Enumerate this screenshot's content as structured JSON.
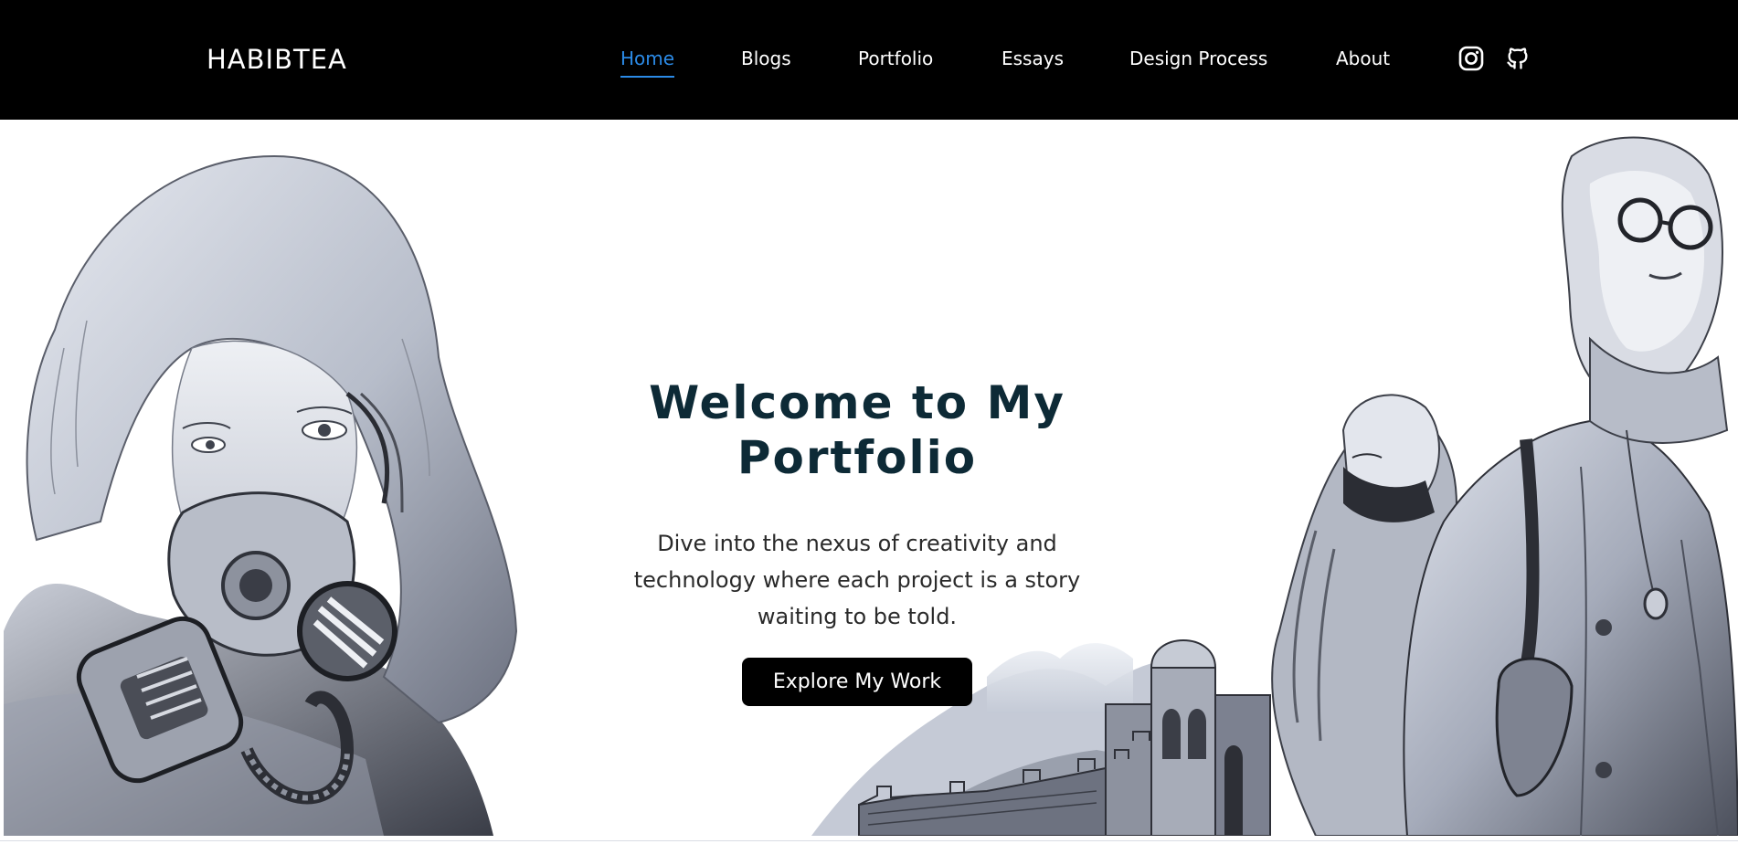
{
  "brand": {
    "name": "HABIBTEA"
  },
  "nav": {
    "items": [
      {
        "label": "Home",
        "active": true
      },
      {
        "label": "Blogs",
        "active": false
      },
      {
        "label": "Portfolio",
        "active": false
      },
      {
        "label": "Essays",
        "active": false
      },
      {
        "label": "Design Process",
        "active": false
      },
      {
        "label": "About",
        "active": false
      }
    ],
    "social": [
      {
        "icon": "instagram-icon"
      },
      {
        "icon": "github-icon"
      }
    ],
    "active_color": "#2b8ae6"
  },
  "hero": {
    "title_line1": "Welcome to My",
    "title_line2": "Portfolio",
    "subtitle": "Dive into the nexus of creativity and technology where each project is a story waiting to be told.",
    "cta_label": "Explore My Work",
    "title_color": "#0d2a36",
    "artwork_left": "pencil-drawing-gas-mask-woman",
    "artwork_right": "pencil-drawing-women-and-landscape"
  }
}
